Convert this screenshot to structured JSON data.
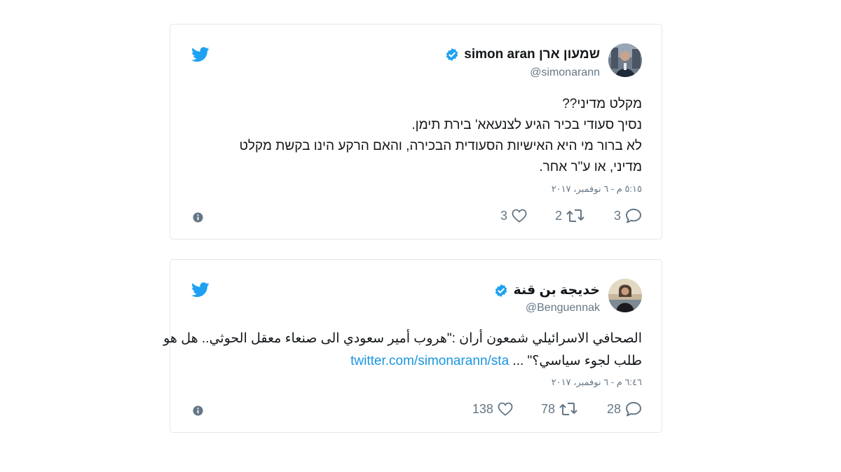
{
  "tweets": [
    {
      "display_name": "שמעון ארן simon aran",
      "handle": "@simonarann",
      "verified": true,
      "text_lines": [
        "מקלט מדיני??",
        "נסיך סעודי בכיר הגיע לצנעאא' בירת תימן.",
        "לא ברור מי היא האישיות הסעודית הבכירה, והאם הרקע הינו בקשת מקלט",
        "מדיני, או ע\"ר אחר."
      ],
      "timestamp": "٥:١٥ م - ٦ نوفمبر، ٢٠١٧",
      "replies": "3",
      "retweets": "2",
      "likes": "3"
    },
    {
      "display_name": "خديجة بن قنة",
      "handle": "@Benguennak",
      "verified": true,
      "text_lines": [
        "الصحافي الاسرائيلي شمعون أران :\"هروب أمير سعودي الى صنعاء معقل الحوثي.. هل هو",
        "طلب لجوء سياسي؟\" ..."
      ],
      "link_text": "twitter.com/simonarann/sta",
      "timestamp": "٦:٤٦ م - ٦ نوفمبر، ٢٠١٧",
      "replies": "28",
      "retweets": "78",
      "likes": "138"
    }
  ],
  "icons": {
    "brand": "twitter-bird-icon",
    "verified": "verified-badge-icon",
    "info": "info-icon",
    "reply": "reply-icon",
    "retweet": "retweet-icon",
    "like": "heart-icon"
  },
  "colors": {
    "brand_blue": "#1da1f2",
    "link_blue": "#1b95e0",
    "muted_gray": "#657786",
    "border": "#e1e8ed",
    "text": "#14171a"
  }
}
